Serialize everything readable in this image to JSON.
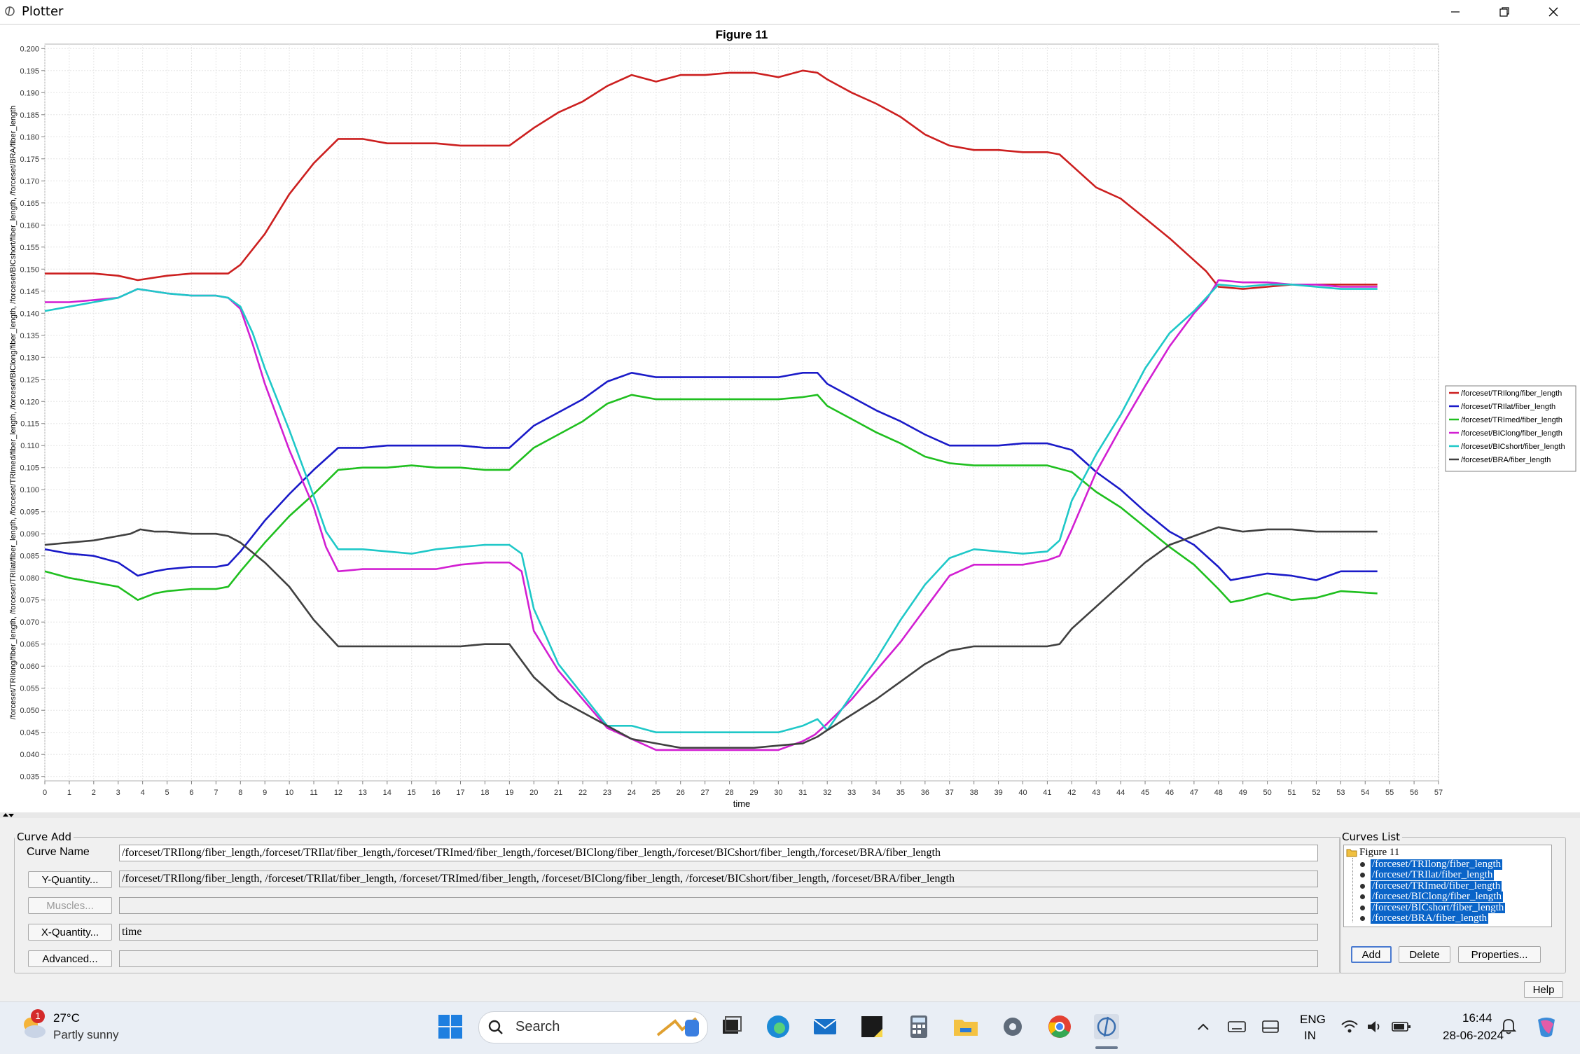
{
  "window": {
    "title": "Plotter"
  },
  "chart_data": {
    "type": "line",
    "title": "Figure 11",
    "xlabel": "time",
    "ylabel": "/forceset/TRIlong/fiber_length, /forceset/TRIlat/fiber_length, /forceset/TRImed/fiber_length, /forceset/BIClong/fiber_length, /forceset/BICshort/fiber_length, /forceset/BRA/fiber_length",
    "xlim": [
      0,
      57
    ],
    "ylim": [
      0.034,
      0.201
    ],
    "xticks": [
      0,
      1,
      2,
      3,
      4,
      5,
      6,
      7,
      8,
      9,
      10,
      11,
      12,
      13,
      14,
      15,
      16,
      17,
      18,
      19,
      20,
      21,
      22,
      23,
      24,
      25,
      26,
      27,
      28,
      29,
      30,
      31,
      32,
      33,
      34,
      35,
      36,
      37,
      38,
      39,
      40,
      41,
      42,
      43,
      44,
      45,
      46,
      47,
      48,
      49,
      50,
      51,
      52,
      53,
      54,
      55,
      56,
      57
    ],
    "yticks": [
      "0.035",
      "0.040",
      "0.045",
      "0.050",
      "0.055",
      "0.060",
      "0.065",
      "0.070",
      "0.075",
      "0.080",
      "0.085",
      "0.090",
      "0.095",
      "0.100",
      "0.105",
      "0.110",
      "0.115",
      "0.120",
      "0.125",
      "0.130",
      "0.135",
      "0.140",
      "0.145",
      "0.150",
      "0.155",
      "0.160",
      "0.165",
      "0.170",
      "0.175",
      "0.180",
      "0.185",
      "0.190",
      "0.195",
      "0.200"
    ],
    "grid": true,
    "legend_position": "right",
    "series": [
      {
        "name": "/forceset/TRIlong/fiber_length",
        "color": "#cc1f1f",
        "x": [
          0,
          1,
          2,
          3,
          3.8,
          5,
          6,
          7,
          7.5,
          8,
          9,
          10,
          11,
          12,
          13,
          14,
          15,
          16,
          17,
          18,
          19,
          20,
          21,
          22,
          23,
          24,
          25,
          26,
          27,
          28,
          29,
          30,
          31,
          31.6,
          32,
          33,
          34,
          35,
          36,
          37,
          38,
          39,
          40,
          41,
          41.5,
          42,
          43,
          44,
          45,
          46,
          47,
          47.5,
          48,
          49,
          50,
          51,
          52,
          53,
          54.5
        ],
        "y": [
          0.149,
          0.149,
          0.149,
          0.1485,
          0.1475,
          0.1485,
          0.149,
          0.149,
          0.149,
          0.151,
          0.158,
          0.167,
          0.174,
          0.1795,
          0.1795,
          0.1785,
          0.1785,
          0.1785,
          0.178,
          0.178,
          0.178,
          0.182,
          0.1855,
          0.188,
          0.1915,
          0.194,
          0.1925,
          0.194,
          0.194,
          0.1945,
          0.1945,
          0.1935,
          0.195,
          0.1945,
          0.193,
          0.19,
          0.1875,
          0.1845,
          0.1805,
          0.178,
          0.177,
          0.177,
          0.1765,
          0.1765,
          0.176,
          0.1735,
          0.1685,
          0.166,
          0.1615,
          0.157,
          0.152,
          0.1495,
          0.146,
          0.1455,
          0.146,
          0.1465,
          0.1465,
          0.1465,
          0.1465
        ]
      },
      {
        "name": "/forceset/TRIlat/fiber_length",
        "color": "#1a1ac8",
        "x": [
          0,
          1,
          2,
          3,
          3.8,
          4.5,
          5,
          6,
          7,
          7.5,
          8,
          9,
          10,
          11,
          12,
          13,
          14,
          15,
          16,
          17,
          18,
          19,
          20,
          21,
          22,
          23,
          24,
          25,
          26,
          27,
          28,
          29,
          30,
          31,
          31.6,
          32,
          33,
          34,
          35,
          36,
          37,
          38,
          39,
          40,
          41,
          42,
          43,
          44,
          45,
          46,
          47,
          48,
          48.5,
          49,
          50,
          51,
          52,
          53,
          54.5
        ],
        "y": [
          0.0865,
          0.0855,
          0.085,
          0.0835,
          0.0805,
          0.0815,
          0.082,
          0.0825,
          0.0825,
          0.083,
          0.086,
          0.093,
          0.099,
          0.1045,
          0.1095,
          0.1095,
          0.11,
          0.11,
          0.11,
          0.11,
          0.1095,
          0.1095,
          0.1145,
          0.1175,
          0.1205,
          0.1245,
          0.1265,
          0.1255,
          0.1255,
          0.1255,
          0.1255,
          0.1255,
          0.1255,
          0.1265,
          0.1265,
          0.124,
          0.121,
          0.118,
          0.1155,
          0.1125,
          0.11,
          0.11,
          0.11,
          0.1105,
          0.1105,
          0.109,
          0.104,
          0.1,
          0.095,
          0.0905,
          0.0875,
          0.0825,
          0.0795,
          0.08,
          0.081,
          0.0805,
          0.0795,
          0.0815,
          0.0815
        ]
      },
      {
        "name": "/forceset/TRImed/fiber_length",
        "color": "#1fbf1f",
        "x": [
          0,
          1,
          2,
          3,
          3.8,
          4.5,
          5,
          6,
          7,
          7.5,
          8,
          9,
          10,
          11,
          12,
          13,
          14,
          15,
          16,
          17,
          18,
          19,
          20,
          21,
          22,
          23,
          24,
          25,
          26,
          27,
          28,
          29,
          30,
          31,
          31.6,
          32,
          33,
          34,
          35,
          36,
          37,
          38,
          39,
          40,
          41,
          42,
          43,
          44,
          45,
          46,
          47,
          48,
          48.5,
          49,
          50,
          51,
          52,
          53,
          54.5
        ],
        "y": [
          0.0815,
          0.08,
          0.079,
          0.078,
          0.075,
          0.0765,
          0.077,
          0.0775,
          0.0775,
          0.078,
          0.0815,
          0.088,
          0.094,
          0.099,
          0.1045,
          0.105,
          0.105,
          0.1055,
          0.105,
          0.105,
          0.1045,
          0.1045,
          0.1095,
          0.1125,
          0.1155,
          0.1195,
          0.1215,
          0.1205,
          0.1205,
          0.1205,
          0.1205,
          0.1205,
          0.1205,
          0.121,
          0.1215,
          0.119,
          0.116,
          0.113,
          0.1105,
          0.1075,
          0.106,
          0.1055,
          0.1055,
          0.1055,
          0.1055,
          0.104,
          0.0995,
          0.096,
          0.0915,
          0.087,
          0.083,
          0.0775,
          0.0745,
          0.075,
          0.0765,
          0.075,
          0.0755,
          0.077,
          0.0765
        ]
      },
      {
        "name": "/forceset/BIClong/fiber_length",
        "color": "#d21fd2",
        "x": [
          0,
          1,
          2,
          3,
          3.8,
          5,
          6,
          7,
          7.5,
          8,
          8.5,
          9,
          10,
          11,
          11.5,
          12,
          13,
          14,
          15,
          16,
          17,
          18,
          19,
          19.5,
          20,
          21,
          22,
          23,
          24,
          25,
          26,
          27,
          28,
          29,
          30,
          31,
          31.5,
          32,
          33,
          34,
          35,
          36,
          37,
          38,
          39,
          40,
          41,
          41.5,
          42,
          43,
          44,
          45,
          46,
          47,
          47.5,
          48,
          49,
          50,
          51,
          52,
          53,
          54.5
        ],
        "y": [
          0.1425,
          0.1425,
          0.143,
          0.1435,
          0.1455,
          0.1445,
          0.144,
          0.144,
          0.1435,
          0.141,
          0.133,
          0.124,
          0.109,
          0.096,
          0.087,
          0.0815,
          0.082,
          0.082,
          0.082,
          0.082,
          0.083,
          0.0835,
          0.0835,
          0.0815,
          0.068,
          0.059,
          0.0525,
          0.046,
          0.0435,
          0.041,
          0.041,
          0.041,
          0.041,
          0.041,
          0.041,
          0.043,
          0.0445,
          0.047,
          0.0525,
          0.059,
          0.0655,
          0.073,
          0.0805,
          0.083,
          0.083,
          0.083,
          0.084,
          0.085,
          0.091,
          0.104,
          0.114,
          0.1235,
          0.1325,
          0.14,
          0.143,
          0.1475,
          0.147,
          0.147,
          0.1465,
          0.1465,
          0.146,
          0.146
        ]
      },
      {
        "name": "/forceset/BICshort/fiber_length",
        "color": "#1fc8c8",
        "x": [
          0,
          1,
          2,
          3,
          3.8,
          5,
          6,
          7,
          7.5,
          8,
          8.5,
          9,
          10,
          11,
          11.5,
          12,
          13,
          14,
          15,
          16,
          17,
          18,
          19,
          19.5,
          20,
          21,
          22,
          23,
          24,
          25,
          26,
          27,
          28,
          29,
          30,
          31,
          31.6,
          32,
          33,
          34,
          35,
          36,
          37,
          38,
          39,
          40,
          41,
          41.5,
          42,
          43,
          44,
          45,
          46,
          47,
          47.5,
          48,
          49,
          50,
          51,
          52,
          53,
          54.5
        ],
        "y": [
          0.1405,
          0.1415,
          0.1425,
          0.1435,
          0.1455,
          0.1445,
          0.144,
          0.144,
          0.1435,
          0.1415,
          0.1355,
          0.1275,
          0.1135,
          0.0985,
          0.0905,
          0.0865,
          0.0865,
          0.086,
          0.0855,
          0.0865,
          0.087,
          0.0875,
          0.0875,
          0.0855,
          0.073,
          0.0605,
          0.0535,
          0.0465,
          0.0465,
          0.045,
          0.045,
          0.045,
          0.045,
          0.045,
          0.045,
          0.0465,
          0.048,
          0.0455,
          0.0535,
          0.0615,
          0.0705,
          0.0785,
          0.0845,
          0.0865,
          0.086,
          0.0855,
          0.086,
          0.0885,
          0.0975,
          0.108,
          0.117,
          0.1275,
          0.1355,
          0.1405,
          0.1435,
          0.1465,
          0.146,
          0.1465,
          0.1465,
          0.146,
          0.1455,
          0.1455
        ]
      },
      {
        "name": "/forceset/BRA/fiber_length",
        "color": "#404040",
        "x": [
          0,
          1,
          2,
          3,
          3.5,
          3.9,
          4.5,
          5,
          6,
          7,
          7.5,
          8,
          9,
          10,
          11,
          12,
          13,
          14,
          15,
          16,
          17,
          18,
          19,
          20,
          21,
          22,
          23,
          24,
          25,
          26,
          27,
          28,
          29,
          30,
          31,
          31.6,
          32,
          33,
          34,
          35,
          36,
          37,
          38,
          39,
          40,
          41,
          41.5,
          42,
          43,
          44,
          45,
          46,
          47,
          48,
          49,
          50,
          51,
          52,
          53,
          54.5
        ],
        "y": [
          0.0875,
          0.088,
          0.0885,
          0.0895,
          0.09,
          0.091,
          0.0905,
          0.0905,
          0.09,
          0.09,
          0.0895,
          0.088,
          0.0835,
          0.078,
          0.0705,
          0.0645,
          0.0645,
          0.0645,
          0.0645,
          0.0645,
          0.0645,
          0.065,
          0.065,
          0.0575,
          0.0525,
          0.0495,
          0.0465,
          0.0435,
          0.0425,
          0.0415,
          0.0415,
          0.0415,
          0.0415,
          0.042,
          0.0425,
          0.044,
          0.0455,
          0.049,
          0.0525,
          0.0565,
          0.0605,
          0.0635,
          0.0645,
          0.0645,
          0.0645,
          0.0645,
          0.065,
          0.0685,
          0.0735,
          0.0785,
          0.0835,
          0.0875,
          0.0895,
          0.0915,
          0.0905,
          0.091,
          0.091,
          0.0905,
          0.0905,
          0.0905
        ]
      }
    ]
  },
  "curve_add": {
    "legend": "Curve Add",
    "curve_name_label": "Curve Name",
    "curve_name_value": "/forceset/TRIlong/fiber_length,/forceset/TRIlat/fiber_length,/forceset/TRImed/fiber_length,/forceset/BIClong/fiber_length,/forceset/BICshort/fiber_length,/forceset/BRA/fiber_length",
    "y_quantity_button": "Y-Quantity...",
    "y_quantity_value": "/forceset/TRIlong/fiber_length, /forceset/TRIlat/fiber_length, /forceset/TRImed/fiber_length, /forceset/BIClong/fiber_length, /forceset/BICshort/fiber_length, /forceset/BRA/fiber_length",
    "muscles_button": "Muscles...",
    "muscles_value": "",
    "x_quantity_button": "X-Quantity...",
    "x_quantity_value": "time",
    "advanced_button": "Advanced...",
    "advanced_value": ""
  },
  "curves_list": {
    "legend": "Curves List",
    "root": "Figure 11",
    "items": [
      "/forceset/TRIlong/fiber_length",
      "/forceset/TRIlat/fiber_length",
      "/forceset/TRImed/fiber_length",
      "/forceset/BIClong/fiber_length",
      "/forceset/BICshort/fiber_length",
      "/forceset/BRA/fiber_length"
    ],
    "add_button": "Add",
    "delete_button": "Delete",
    "properties_button": "Properties..."
  },
  "help_button": "Help",
  "taskbar": {
    "weather_temp": "27°C",
    "weather_desc": "Partly sunny",
    "weather_badge": "1",
    "search_placeholder": "Search",
    "lang_top": "ENG",
    "lang_bottom": "IN",
    "time": "16:44",
    "date": "28-06-2024"
  }
}
